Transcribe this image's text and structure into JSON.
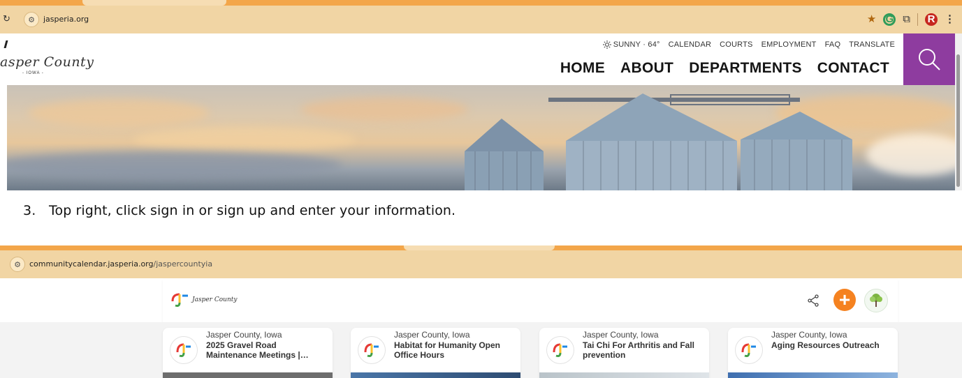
{
  "shot1": {
    "url": "jasperia.org",
    "logo": {
      "name": "asper County",
      "sub": "- IOWA -"
    },
    "utility_nav": {
      "weather": "SUNNY · 64°",
      "items": [
        "CALENDAR",
        "COURTS",
        "EMPLOYMENT",
        "FAQ",
        "TRANSLATE"
      ]
    },
    "main_nav": [
      "HOME",
      "ABOUT",
      "DEPARTMENTS",
      "CONTACT"
    ],
    "avatar_initial": "R",
    "colors": {
      "accent_purple": "#8e3c9f",
      "toolbar": "#f1d5a4",
      "tabstrip": "#f3a64a"
    }
  },
  "instruction": {
    "number": "3.",
    "text": "Top right, click sign in or sign up and enter your information."
  },
  "shot2": {
    "url_host": "communitycalendar.jasperia.org",
    "url_path": "/jaspercountyia",
    "logo_text": "Jasper County",
    "cards": [
      {
        "org": "Jasper County, Iowa",
        "title": "2025 Gravel Road Maintenance Meetings |…"
      },
      {
        "org": "Jasper County, Iowa",
        "title": "Habitat for Humanity Open Office Hours"
      },
      {
        "org": "Jasper County, Iowa",
        "title": "Tai Chi For Arthritis and Fall prevention"
      },
      {
        "org": "Jasper County, Iowa",
        "title": "Aging Resources Outreach"
      }
    ],
    "colors": {
      "plus_button": "#f58220"
    }
  },
  "icons": [
    "site-info-icon",
    "bookmark-star-icon",
    "grammarly-icon",
    "extensions-icon",
    "profile-avatar",
    "menu-icon",
    "weather-sun-icon",
    "search-icon",
    "share-icon",
    "plus-icon",
    "partner-logo"
  ]
}
